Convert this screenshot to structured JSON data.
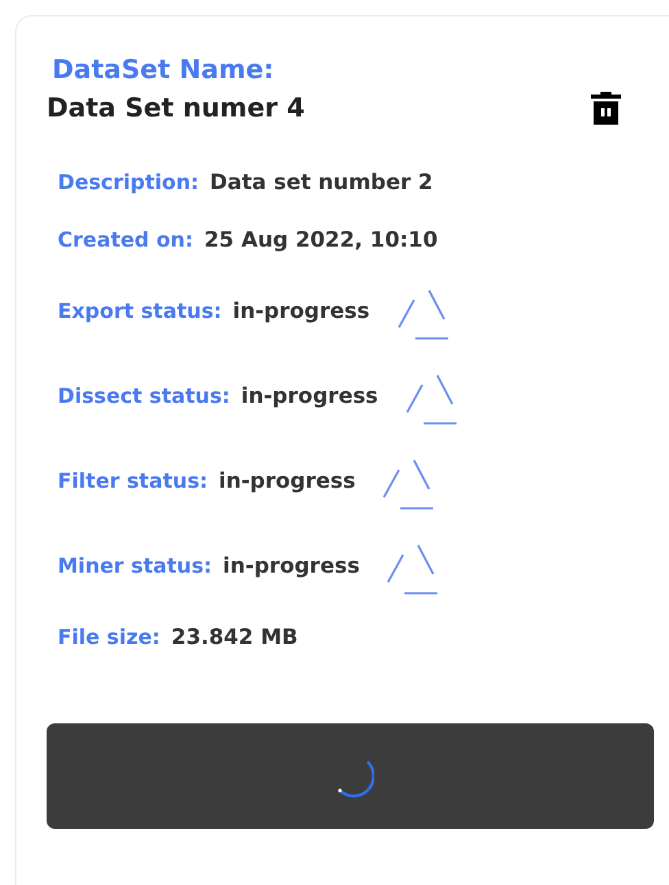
{
  "card": {
    "heading": "DataSet Name:",
    "name": "Data Set numer 4",
    "fields": [
      {
        "kind": "plain",
        "label": "Description:",
        "value": "Data set number 2"
      },
      {
        "kind": "plain",
        "label": "Created on:",
        "value": "25 Aug 2022, 10:10"
      },
      {
        "kind": "status",
        "label": "Export status:",
        "value": "in-progress"
      },
      {
        "kind": "status",
        "label": "Dissect status:",
        "value": "in-progress"
      },
      {
        "kind": "status",
        "label": "Filter status:",
        "value": "in-progress"
      },
      {
        "kind": "status",
        "label": "Miner status:",
        "value": "in-progress"
      },
      {
        "kind": "plain",
        "label": "File size:",
        "value": "23.842 MB"
      }
    ],
    "button": {
      "loading": true
    }
  }
}
